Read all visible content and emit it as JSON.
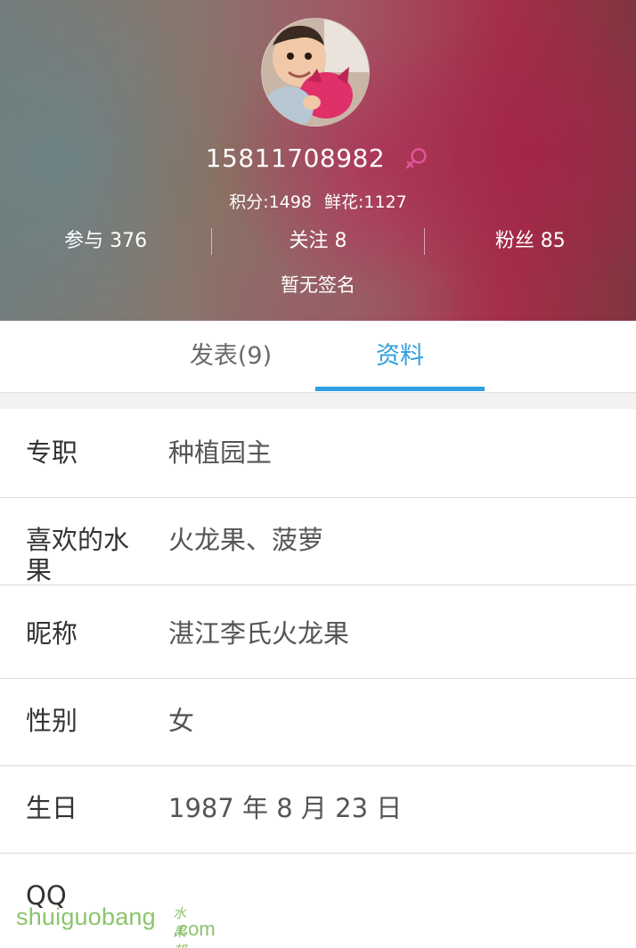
{
  "profile": {
    "username": "15811708982",
    "points_text": "积分:1498",
    "flowers_text": "鲜花:1127",
    "participate": "参与 376",
    "following": "关注 8",
    "fans": "粉丝 85",
    "signature": "暂无签名",
    "gender_icon": "female-symbol-icon"
  },
  "tabs": [
    {
      "label": "发表(9)",
      "active": false
    },
    {
      "label": "资料",
      "active": true
    }
  ],
  "info": [
    {
      "label": "专职",
      "value": "种植园主"
    },
    {
      "label": "喜欢的水果",
      "value": "火龙果、菠萝"
    },
    {
      "label": "昵称",
      "value": "湛江李氏火龙果"
    },
    {
      "label": "性别",
      "value": "女"
    },
    {
      "label": "生日",
      "value": "1987 年 8 月 23 日"
    },
    {
      "label": "QQ",
      "value": ""
    }
  ],
  "watermark": {
    "main": "shuiguobang",
    "sub": ".com",
    "cn": "水果邦"
  },
  "colors": {
    "accent": "#2e9fe0",
    "female_symbol": "#e0559a"
  }
}
